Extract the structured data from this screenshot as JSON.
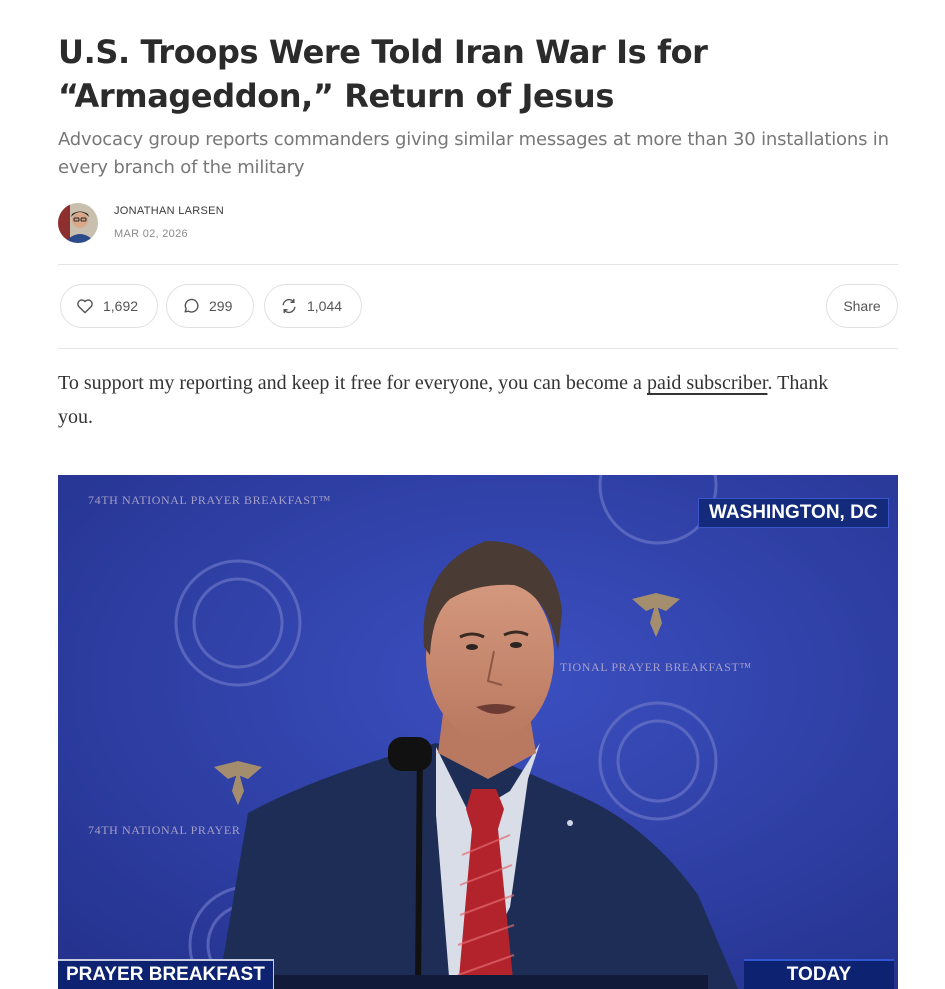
{
  "article": {
    "title": "U.S. Troops Were Told Iran War Is for “Armageddon,” Return of Jesus",
    "subtitle": "Advocacy group reports commanders giving similar messages at more than 30 installations in every branch of the military"
  },
  "byline": {
    "author": "JONATHAN LARSEN",
    "date": "MAR 02, 2026"
  },
  "actions": {
    "likes": "1,692",
    "comments": "299",
    "restacks": "1,044",
    "share_label": "Share"
  },
  "support": {
    "text_before": "To support my reporting and keep it free for everyone, you can become a ",
    "link_text": "paid subscriber",
    "text_after": ". Thank you."
  },
  "video": {
    "backdrop_banner_top": "74TH NATIONAL PRAYER BREAKFAST™",
    "backdrop_banner_right": "TIONAL PRAYER BREAKFAST™",
    "backdrop_banner_left": "74TH NATIONAL PRAYER",
    "location_chip": "WASHINGTON, DC",
    "program_chip": "PRAYER BREAKFAST",
    "today_chip": "TODAY"
  },
  "colors": {
    "backdrop_blue": "#2f3fa6",
    "chip_navy": "#142a7a",
    "tie_red": "#b3232c"
  }
}
